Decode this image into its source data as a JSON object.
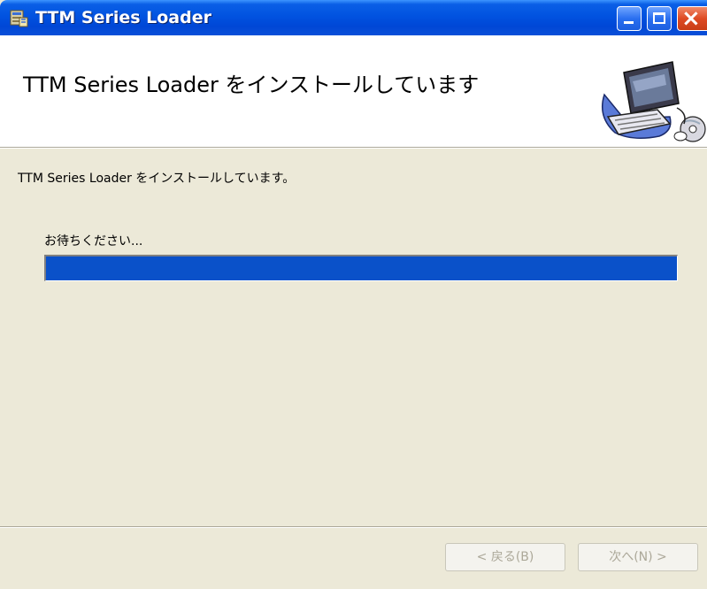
{
  "window": {
    "title": "TTM Series Loader"
  },
  "banner": {
    "title": "TTM Series Loader をインストールしています",
    "icon": "computer-setup-icon"
  },
  "main": {
    "description": "TTM Series Loader をインストールしています。",
    "wait_label": "お待ちください...",
    "progress": 1.0
  },
  "footer": {
    "back_label": "< 戻る(B)",
    "next_label": "次へ(N) >"
  },
  "colors": {
    "titlebar": "#0153e0",
    "progress_fill": "#0a51c9",
    "dialog_bg": "#ece9d8"
  }
}
